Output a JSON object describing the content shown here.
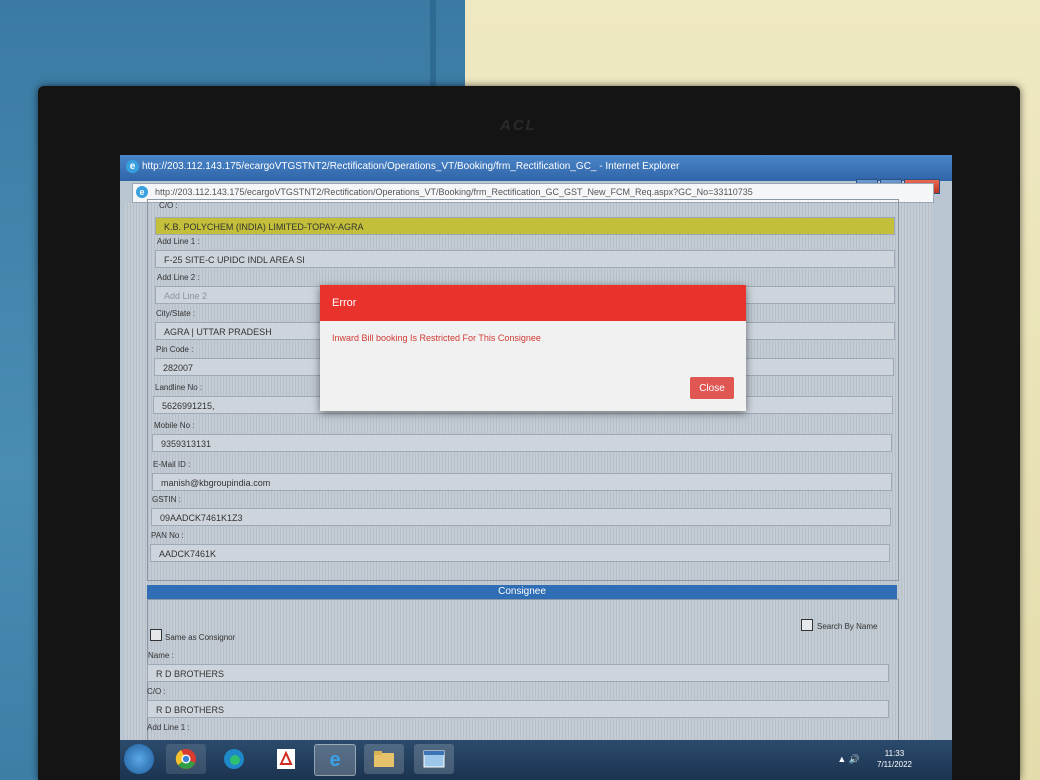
{
  "browser": {
    "window_title": "http://203.112.143.175/ecargoVTGSTNT2/Rectification/Operations_VT/Booking/frm_Rectification_GC_ - Internet Explorer",
    "address": "http://203.112.143.175/ecargoVTGSTNT2/Rectification/Operations_VT/Booking/frm_Rectification_GC_GST_New_FCM_Req.aspx?GC_No=33110735"
  },
  "monitor_brand": "ACL",
  "consignor": {
    "co_label": "C/O :",
    "co_value": "K.B. POLYCHEM (INDIA) LIMITED-TOPAY-AGRA",
    "add1_label": "Add Line 1 :",
    "add1_value": "F-25 SITE-C UPIDC INDL AREA SI",
    "add2_label": "Add Line 2 :",
    "add2_placeholder": "Add Line 2",
    "city_label": "City/State :",
    "city_value": "AGRA | UTTAR PRADESH",
    "pin_label": "Pin Code :",
    "pin_value": "282007",
    "landline_label": "Landline No :",
    "landline_value": "5626991215,",
    "mobile_label": "Mobile No :",
    "mobile_value": "9359313131",
    "email_label": "E-Mail ID :",
    "email_value": "manish@kbgroupindia.com",
    "gstin_label": "GSTIN :",
    "gstin_value": "09AADCK7461K1Z3",
    "pan_label": "PAN No :",
    "pan_value": "AADCK7461K"
  },
  "consignee": {
    "section_title": "Consignee",
    "same_as_label": "Same as Consignor",
    "search_by_name_label": "Search By Name",
    "name_label": "Name :",
    "name_value": "R D BROTHERS",
    "co_label": "C/O :",
    "co_value": "R D BROTHERS",
    "add1_label": "Add Line 1 :"
  },
  "modal": {
    "title": "Error",
    "message": "Inward Bill booking Is Restricted For This Consignee",
    "close_label": "Close"
  },
  "taskbar": {
    "time": "11:33",
    "date": "7/11/2022"
  },
  "colors": {
    "error_header": "#e8322b",
    "close_button": "#df5653",
    "consignee_bar": "#2f6db5",
    "highlight_field": "#c3bf3a"
  }
}
